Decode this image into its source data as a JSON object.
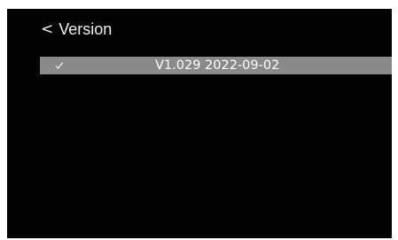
{
  "header": {
    "back_glyph": "<",
    "title": "Version",
    "back_icon": "chevron-left-icon"
  },
  "version_list": {
    "items": [
      {
        "label": "V1.029 2022-09-02",
        "selected": true,
        "icon": "check-icon"
      }
    ]
  },
  "colors": {
    "screen_background": "#030303",
    "selection_highlight": "#8a8a8a",
    "text": "#ffffff"
  }
}
